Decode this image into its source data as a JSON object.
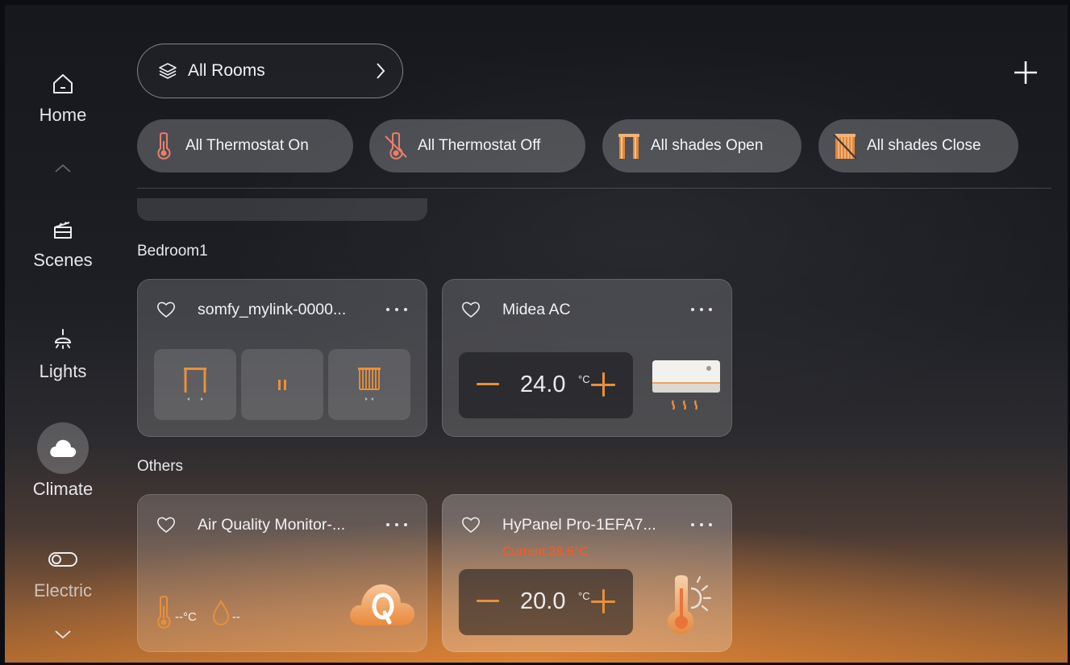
{
  "sidebar": {
    "items": [
      {
        "label": "Home",
        "icon": "home-icon"
      },
      {
        "label": "Scenes",
        "icon": "clapperboard-icon"
      },
      {
        "label": "Lights",
        "icon": "ceiling-lamp-icon"
      },
      {
        "label": "Climate",
        "icon": "cloud-icon",
        "active": true
      },
      {
        "label": "Electric",
        "icon": "toggle-switch-icon"
      }
    ]
  },
  "header": {
    "rooms_label": "All Rooms",
    "add_icon": "plus-icon"
  },
  "scenes": [
    {
      "label": "All Thermostat On",
      "icon": "thermometer-icon"
    },
    {
      "label": "All Thermostat Off",
      "icon": "thermometer-off-icon"
    },
    {
      "label": "All shades Open",
      "icon": "shades-open-icon"
    },
    {
      "label": "All shades Close",
      "icon": "shades-close-icon"
    }
  ],
  "sections": {
    "bedroom": {
      "title": "Bedroom1",
      "devices": [
        {
          "name": "somfy_mylink-0000...",
          "controls": [
            "shade-open-icon",
            "pause-icon",
            "shade-close-icon"
          ]
        },
        {
          "name": "Midea AC",
          "temperature": "24.0",
          "unit": "°C",
          "icon": "ac-heat-icon"
        }
      ]
    },
    "others": {
      "title": "Others",
      "devices": [
        {
          "name": "Air Quality Monitor-...",
          "temp_reading": "--°C",
          "humidity_reading": "--",
          "icon": "cloud-q-icon"
        },
        {
          "name": "HyPanel Pro-1EFA7...",
          "current": "Current:28.6°C",
          "temperature": "20.0",
          "unit": "°C",
          "icon": "thermometer-sun-icon"
        }
      ]
    }
  },
  "colors": {
    "accent": "#e8903a",
    "current_text": "#ff5a1f"
  }
}
